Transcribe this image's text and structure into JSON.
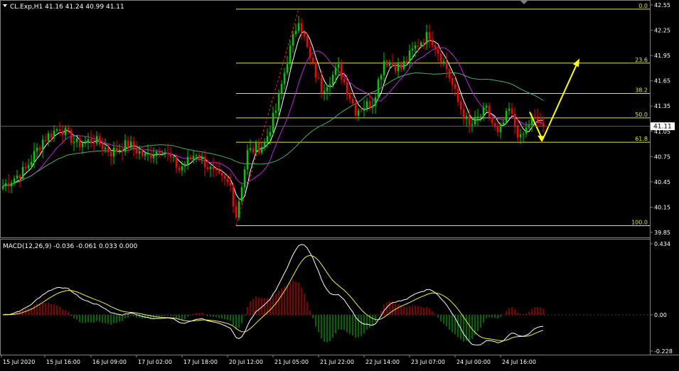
{
  "header": {
    "symbol_line": "CL.Exp,H1  41.16 41.24 40.99 41.11",
    "macd_line": "MACD(12,26,9) -0.036 -0.061 0.033 0.000"
  },
  "colors": {
    "background": "#000000",
    "bull_candle": "#00cc00",
    "bear_candle": "#ff0000",
    "fibo": "#e5e540",
    "ma_fast": "#ffffff",
    "ma_mid": "#c020e0",
    "ma_slow": "#3cb371",
    "macd_main": "#ffffff",
    "macd_signal": "#f0f040",
    "arrow": "#ffff00",
    "current_price_box": "#ffffff"
  },
  "price_axis": {
    "labels": [
      "42.55",
      "42.25",
      "41.95",
      "41.65",
      "41.35",
      "41.05",
      "40.75",
      "40.45",
      "40.15",
      "39.85"
    ],
    "current_price": "41.11"
  },
  "macd_axis": {
    "labels": [
      "0.434",
      "0.00",
      "-0.228"
    ]
  },
  "time_axis": {
    "labels": [
      "15 Jul 2020",
      "15 Jul 16:00",
      "16 Jul 09:00",
      "17 Jul 02:00",
      "17 Jul 18:00",
      "20 Jul 12:00",
      "21 Jul 05:00",
      "21 Jul 22:00",
      "22 Jul 14:00",
      "23 Jul 07:00",
      "24 Jul 00:00",
      "24 Jul 16:00"
    ]
  },
  "fibonacci": {
    "levels": [
      {
        "label": "0.0",
        "price": 42.5
      },
      {
        "label": "23.6",
        "price": 41.86
      },
      {
        "label": "38.2",
        "price": 41.5
      },
      {
        "label": "50.0",
        "price": 41.21
      },
      {
        "label": "61.8",
        "price": 40.92
      },
      {
        "label": "100.0",
        "price": 39.93
      }
    ]
  },
  "chart_data": {
    "type": "candlestick",
    "price_range": [
      39.8,
      42.6
    ],
    "macd_range": [
      -0.26,
      0.45
    ],
    "anchors": [
      {
        "t": 0,
        "p": 40.4
      },
      {
        "t": 8,
        "p": 40.6
      },
      {
        "t": 14,
        "p": 40.95
      },
      {
        "t": 20,
        "p": 41.1
      },
      {
        "t": 26,
        "p": 40.9
      },
      {
        "t": 32,
        "p": 40.95
      },
      {
        "t": 38,
        "p": 40.8
      },
      {
        "t": 44,
        "p": 40.9
      },
      {
        "t": 50,
        "p": 40.75
      },
      {
        "t": 56,
        "p": 40.85
      },
      {
        "t": 62,
        "p": 40.6
      },
      {
        "t": 68,
        "p": 40.8
      },
      {
        "t": 74,
        "p": 40.55
      },
      {
        "t": 80,
        "p": 40.4
      },
      {
        "t": 82,
        "p": 40.05
      },
      {
        "t": 86,
        "p": 40.8
      },
      {
        "t": 92,
        "p": 40.9
      },
      {
        "t": 96,
        "p": 41.3
      },
      {
        "t": 100,
        "p": 41.9
      },
      {
        "t": 104,
        "p": 42.4
      },
      {
        "t": 108,
        "p": 41.9
      },
      {
        "t": 112,
        "p": 41.55
      },
      {
        "t": 118,
        "p": 41.8
      },
      {
        "t": 124,
        "p": 41.3
      },
      {
        "t": 130,
        "p": 41.4
      },
      {
        "t": 134,
        "p": 41.9
      },
      {
        "t": 140,
        "p": 41.8
      },
      {
        "t": 146,
        "p": 42.1
      },
      {
        "t": 150,
        "p": 42.2
      },
      {
        "t": 156,
        "p": 41.8
      },
      {
        "t": 160,
        "p": 41.4
      },
      {
        "t": 164,
        "p": 41.1
      },
      {
        "t": 170,
        "p": 41.3
      },
      {
        "t": 174,
        "p": 41.0
      },
      {
        "t": 178,
        "p": 41.3
      },
      {
        "t": 182,
        "p": 40.95
      },
      {
        "t": 186,
        "p": 41.2
      },
      {
        "t": 190,
        "p": 41.15
      }
    ],
    "projection": [
      {
        "label": "start",
        "price": 41.28
      },
      {
        "label": "dip",
        "price": 40.95
      },
      {
        "label": "target",
        "price": 41.88
      }
    ]
  }
}
